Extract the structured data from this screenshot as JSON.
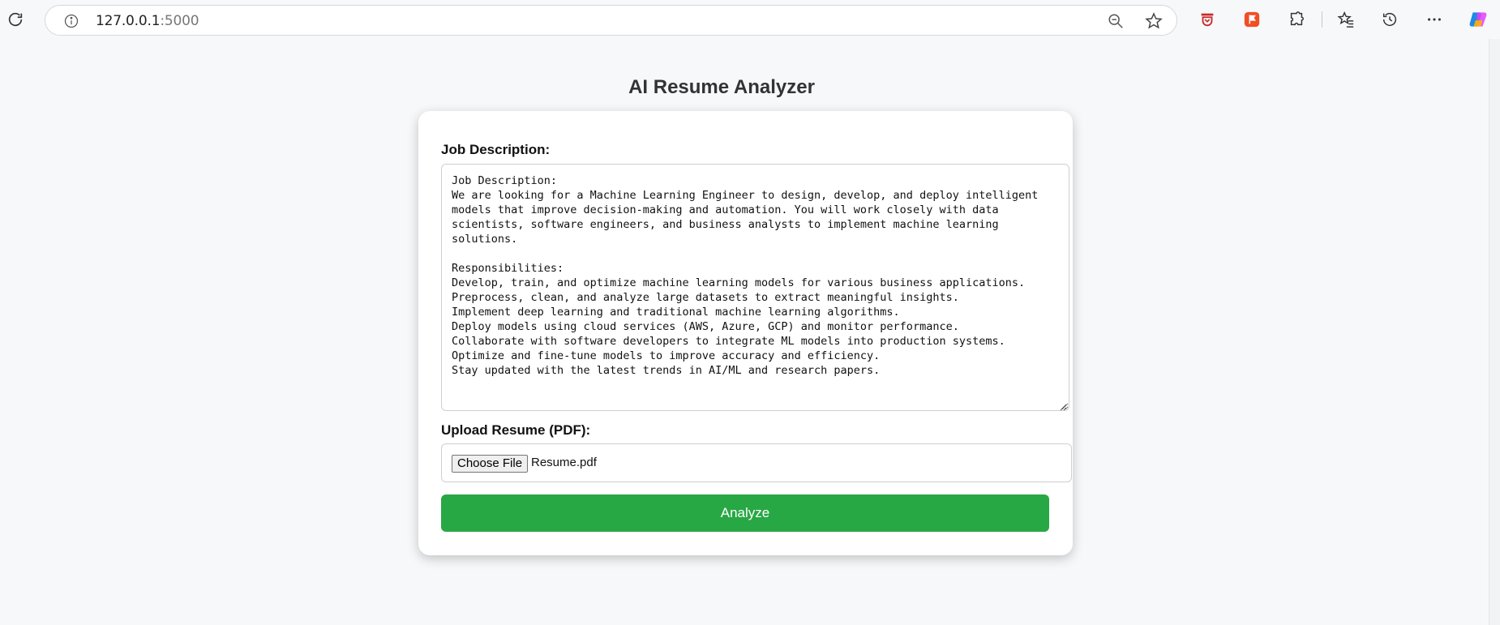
{
  "browser": {
    "url_host": "127.0.0.1",
    "url_port": ":5000"
  },
  "page": {
    "title": "AI Resume Analyzer"
  },
  "form": {
    "job_label": "Job Description:",
    "job_text": "Job Description:\nWe are looking for a Machine Learning Engineer to design, develop, and deploy intelligent\nmodels that improve decision-making and automation. You will work closely with data\nscientists, software engineers, and business analysts to implement machine learning\nsolutions.\n\nResponsibilities:\nDevelop, train, and optimize machine learning models for various business applications.\nPreprocess, clean, and analyze large datasets to extract meaningful insights.\nImplement deep learning and traditional machine learning algorithms.\nDeploy models using cloud services (AWS, Azure, GCP) and monitor performance.\nCollaborate with software developers to integrate ML models into production systems.\nOptimize and fine-tune models to improve accuracy and efficiency.\nStay updated with the latest trends in AI/ML and research papers.",
    "upload_label": "Upload Resume (PDF):",
    "choose_file_label": "Choose File",
    "file_name": "Resume.pdf",
    "analyze_label": "Analyze"
  },
  "colors": {
    "accent": "#28a745",
    "background": "#f7f8fa"
  }
}
